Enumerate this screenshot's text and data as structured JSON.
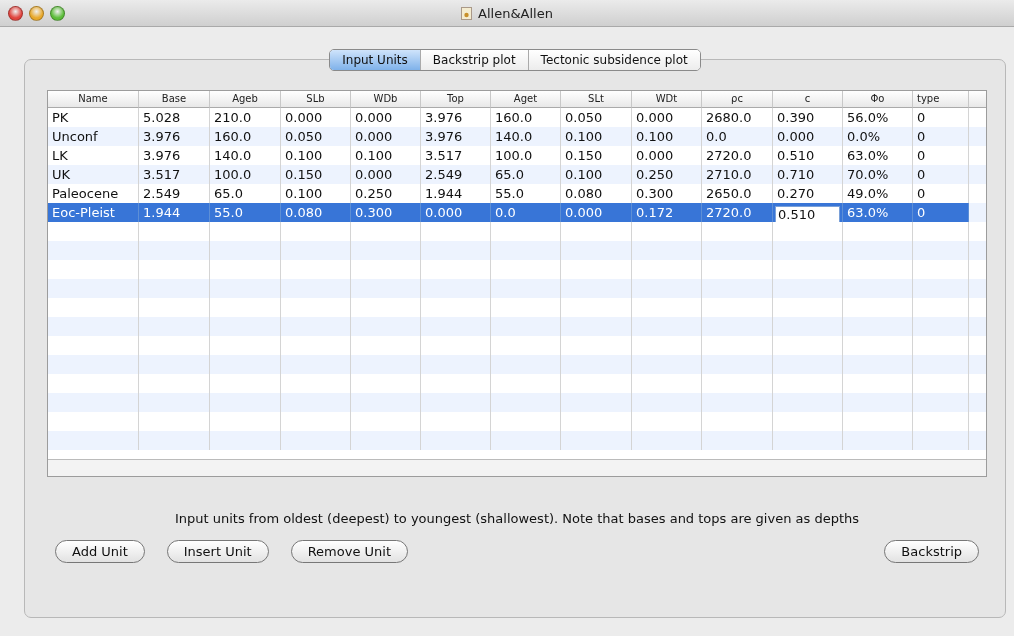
{
  "window": {
    "title": "Allen&Allen"
  },
  "tabs": [
    {
      "label": "Input Units",
      "selected": true
    },
    {
      "label": "Backstrip plot",
      "selected": false
    },
    {
      "label": "Tectonic subsidence plot",
      "selected": false
    }
  ],
  "table": {
    "columns": [
      "Name",
      "Base",
      "Ageb",
      "SLb",
      "WDb",
      "Top",
      "Aget",
      "SLt",
      "WDt",
      "ρc",
      "c",
      "Φo",
      "type"
    ],
    "rows": [
      {
        "selected": false,
        "cells": [
          {
            "text": "PK",
            "editing": false
          },
          {
            "text": "5.028",
            "editing": false
          },
          {
            "text": "210.0",
            "editing": false
          },
          {
            "text": "0.000",
            "editing": false
          },
          {
            "text": "0.000",
            "editing": false
          },
          {
            "text": "3.976",
            "editing": false
          },
          {
            "text": "160.0",
            "editing": false
          },
          {
            "text": "0.050",
            "editing": false
          },
          {
            "text": "0.000",
            "editing": false
          },
          {
            "text": "2680.0",
            "editing": false
          },
          {
            "text": "0.390",
            "editing": false
          },
          {
            "text": "56.0%",
            "editing": false
          },
          {
            "text": "0",
            "editing": false
          }
        ]
      },
      {
        "selected": false,
        "cells": [
          {
            "text": "Unconf",
            "editing": false
          },
          {
            "text": "3.976",
            "editing": false
          },
          {
            "text": "160.0",
            "editing": false
          },
          {
            "text": "0.050",
            "editing": false
          },
          {
            "text": "0.000",
            "editing": false
          },
          {
            "text": "3.976",
            "editing": false
          },
          {
            "text": "140.0",
            "editing": false
          },
          {
            "text": "0.100",
            "editing": false
          },
          {
            "text": "0.100",
            "editing": false
          },
          {
            "text": "0.0",
            "editing": false
          },
          {
            "text": "0.000",
            "editing": false
          },
          {
            "text": "0.0%",
            "editing": false
          },
          {
            "text": "0",
            "editing": false
          }
        ]
      },
      {
        "selected": false,
        "cells": [
          {
            "text": "LK",
            "editing": false
          },
          {
            "text": "3.976",
            "editing": false
          },
          {
            "text": "140.0",
            "editing": false
          },
          {
            "text": "0.100",
            "editing": false
          },
          {
            "text": "0.100",
            "editing": false
          },
          {
            "text": "3.517",
            "editing": false
          },
          {
            "text": "100.0",
            "editing": false
          },
          {
            "text": "0.150",
            "editing": false
          },
          {
            "text": "0.000",
            "editing": false
          },
          {
            "text": "2720.0",
            "editing": false
          },
          {
            "text": "0.510",
            "editing": false
          },
          {
            "text": "63.0%",
            "editing": false
          },
          {
            "text": "0",
            "editing": false
          }
        ]
      },
      {
        "selected": false,
        "cells": [
          {
            "text": "UK",
            "editing": false
          },
          {
            "text": "3.517",
            "editing": false
          },
          {
            "text": "100.0",
            "editing": false
          },
          {
            "text": "0.150",
            "editing": false
          },
          {
            "text": "0.000",
            "editing": false
          },
          {
            "text": "2.549",
            "editing": false
          },
          {
            "text": "65.0",
            "editing": false
          },
          {
            "text": "0.100",
            "editing": false
          },
          {
            "text": "0.250",
            "editing": false
          },
          {
            "text": "2710.0",
            "editing": false
          },
          {
            "text": "0.710",
            "editing": false
          },
          {
            "text": "70.0%",
            "editing": false
          },
          {
            "text": "0",
            "editing": false
          }
        ]
      },
      {
        "selected": false,
        "cells": [
          {
            "text": "Paleocene",
            "editing": false
          },
          {
            "text": "2.549",
            "editing": false
          },
          {
            "text": "65.0",
            "editing": false
          },
          {
            "text": "0.100",
            "editing": false
          },
          {
            "text": "0.250",
            "editing": false
          },
          {
            "text": "1.944",
            "editing": false
          },
          {
            "text": "55.0",
            "editing": false
          },
          {
            "text": "0.080",
            "editing": false
          },
          {
            "text": "0.300",
            "editing": false
          },
          {
            "text": "2650.0",
            "editing": false
          },
          {
            "text": "0.270",
            "editing": false
          },
          {
            "text": "49.0%",
            "editing": false
          },
          {
            "text": "0",
            "editing": false
          }
        ]
      },
      {
        "selected": true,
        "cells": [
          {
            "text": "Eoc-Pleist",
            "editing": false
          },
          {
            "text": "1.944",
            "editing": false
          },
          {
            "text": "55.0",
            "editing": false
          },
          {
            "text": "0.080",
            "editing": false
          },
          {
            "text": "0.300",
            "editing": false
          },
          {
            "text": "0.000",
            "editing": false
          },
          {
            "text": "0.0",
            "editing": false
          },
          {
            "text": "0.000",
            "editing": false
          },
          {
            "text": "0.172",
            "editing": false
          },
          {
            "text": "2720.0",
            "editing": false
          },
          {
            "text": "0.510",
            "editing": true
          },
          {
            "text": "63.0%",
            "editing": false
          },
          {
            "text": "0",
            "editing": false
          }
        ]
      }
    ]
  },
  "note": "Input units from oldest (deepest) to youngest (shallowest). Note that bases and tops are given as depths",
  "left_buttons": [
    "Add Unit",
    "Insert Unit",
    "Remove Unit"
  ],
  "right_buttons": [
    "Backstrip"
  ]
}
